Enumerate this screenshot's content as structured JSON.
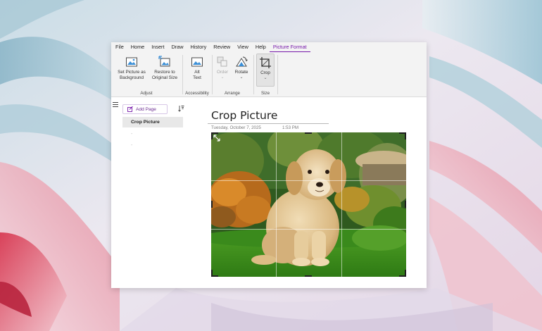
{
  "menu": {
    "items": [
      "File",
      "Home",
      "Insert",
      "Draw",
      "History",
      "Review",
      "View",
      "Help",
      "Picture Format"
    ],
    "active": "Picture Format"
  },
  "ribbon": {
    "adjust": {
      "set_background": [
        "Set Picture as",
        "Background"
      ],
      "restore_size": [
        "Restore to",
        "Original Size"
      ],
      "label": "Adjust"
    },
    "accessibility": {
      "alt_text": [
        "Alt",
        "Text"
      ],
      "label": "Accessibility"
    },
    "arrange": {
      "order": "Order",
      "rotate": "Rotate",
      "label": "Arrange"
    },
    "size": {
      "crop": "Crop",
      "label": "Size"
    }
  },
  "sidebar": {
    "add_page": "Add Page",
    "pages": [
      "Crop Picture"
    ],
    "empty_markers": [
      "-",
      "-"
    ]
  },
  "note": {
    "title": "Crop Picture",
    "date": "Tuesday, October 7, 2025",
    "time": "1:53 PM"
  },
  "colors": {
    "accent": "#7719aa",
    "ribbon_bg": "#f3f3f3",
    "selected_page": "#e8e8e8"
  },
  "icons": {
    "hamburger": "hamburger-icon",
    "add_page": "add-page-icon",
    "sort": "sort-icon",
    "crop": "crop-icon",
    "rotate": "rotate-icon"
  }
}
